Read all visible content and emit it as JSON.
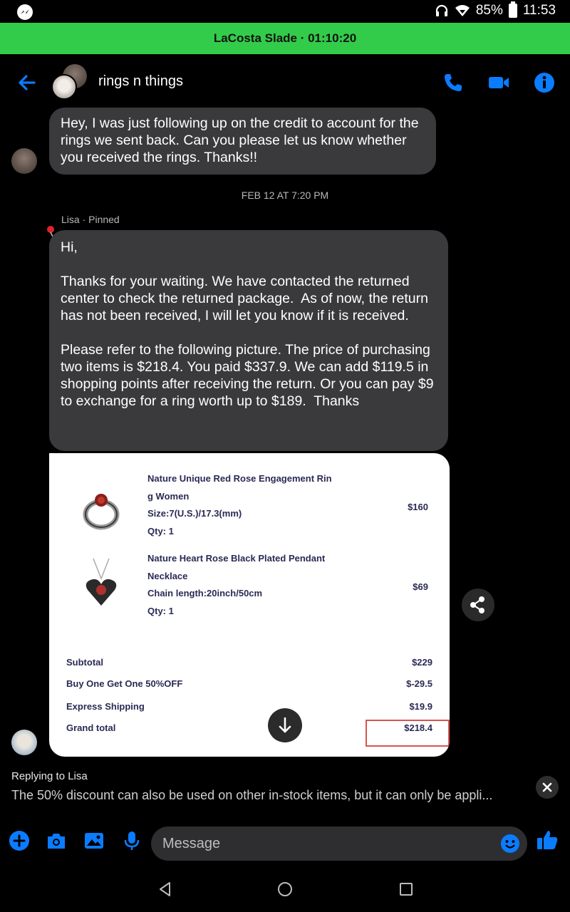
{
  "status_bar": {
    "battery": "85%",
    "time": "11:53"
  },
  "call_banner": {
    "text": "LaCosta Slade · 01:10:20"
  },
  "header": {
    "title": "rings n things"
  },
  "messages": {
    "first": "Hey, I was just following up on the credit to account for the rings we sent back. Can you please let us know whether you received the rings. Thanks!!",
    "timestamp": "FEB 12 AT 7:20 PM",
    "sender_label": "Lisa · Pinned",
    "second": "Hi,\n\nThanks for your waiting. We have contacted the returned center to check the returned package.  As of now, the return has not been received, I will let you know if it is received.\n\nPlease refer to the following picture. The price of purchasing two items is $218.4. You paid $337.9. We can add $119.5 in shopping points after receiving the return. Or you can pay $9 to exchange for a ring worth up to $189.  Thanks"
  },
  "order_image": {
    "items": [
      {
        "name_line1": "Nature Unique Red Rose Engagement Rin",
        "name_line2": "g Women",
        "detail": "Size:7(U.S.)/17.3(mm)",
        "qty": "Qty: 1",
        "price": "$160"
      },
      {
        "name_line1": "Nature Heart Rose Black Plated Pendant",
        "name_line2": "Necklace",
        "detail": "Chain length:20inch/50cm",
        "qty": "Qty: 1",
        "price": "$69"
      }
    ],
    "summary": [
      {
        "label": "Subtotal",
        "value": "$229"
      },
      {
        "label": "Buy One Get One 50%OFF",
        "value": "$-29.5"
      },
      {
        "label": "Express Shipping",
        "value": "$19.9"
      },
      {
        "label": "Grand total",
        "value": "$218.4"
      }
    ]
  },
  "reply": {
    "label": "Replying to Lisa",
    "preview": "The 50% discount can also be used on other in-stock items, but it can only be appli..."
  },
  "composer": {
    "placeholder": "Message"
  },
  "colors": {
    "accent": "#0a7cff",
    "call_banner": "#33cc4a",
    "bubble": "#3a3a3c",
    "highlight": "#d9534f"
  },
  "icons": [
    "messenger-icon",
    "headphones-icon",
    "wifi-icon",
    "battery-icon",
    "back-arrow-icon",
    "phone-icon",
    "video-icon",
    "info-icon",
    "pin-icon",
    "share-icon",
    "scroll-down-icon",
    "close-icon",
    "plus-icon",
    "camera-icon",
    "gallery-icon",
    "mic-icon",
    "emoji-icon",
    "like-icon",
    "nav-back-icon",
    "nav-home-icon",
    "nav-recents-icon"
  ]
}
